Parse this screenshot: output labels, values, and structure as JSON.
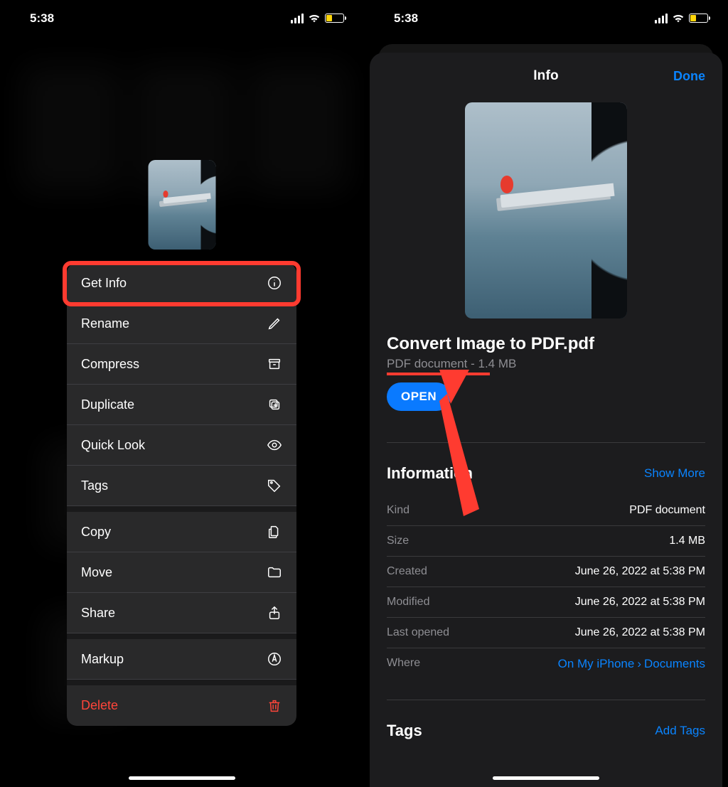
{
  "status": {
    "time": "5:38"
  },
  "left": {
    "menu": {
      "items": [
        {
          "label": "Get Info",
          "icon": "info-icon"
        },
        {
          "label": "Rename",
          "icon": "pencil-icon"
        },
        {
          "label": "Compress",
          "icon": "archive-icon"
        },
        {
          "label": "Duplicate",
          "icon": "duplicate-icon"
        },
        {
          "label": "Quick Look",
          "icon": "eye-icon"
        },
        {
          "label": "Tags",
          "icon": "tag-icon"
        },
        {
          "label": "Copy",
          "icon": "copy-icon"
        },
        {
          "label": "Move",
          "icon": "folder-icon"
        },
        {
          "label": "Share",
          "icon": "share-icon"
        },
        {
          "label": "Markup",
          "icon": "markup-icon"
        },
        {
          "label": "Delete",
          "icon": "trash-icon"
        }
      ]
    }
  },
  "right": {
    "header": {
      "title": "Info",
      "done": "Done"
    },
    "file": {
      "name": "Convert Image to PDF.pdf",
      "subtitle": "PDF document - 1.4 MB",
      "open_label": "OPEN"
    },
    "information": {
      "heading": "Information",
      "show_more": "Show More",
      "rows": {
        "kind": {
          "key": "Kind",
          "value": "PDF document"
        },
        "size": {
          "key": "Size",
          "value": "1.4 MB"
        },
        "created": {
          "key": "Created",
          "value": "June 26, 2022 at 5:38 PM"
        },
        "modified": {
          "key": "Modified",
          "value": "June 26, 2022 at 5:38 PM"
        },
        "last_opened": {
          "key": "Last opened",
          "value": "June 26, 2022 at 5:38 PM"
        },
        "where": {
          "key": "Where",
          "value_a": "On My iPhone",
          "value_b": "Documents"
        }
      }
    },
    "tags": {
      "heading": "Tags",
      "add": "Add Tags"
    }
  }
}
